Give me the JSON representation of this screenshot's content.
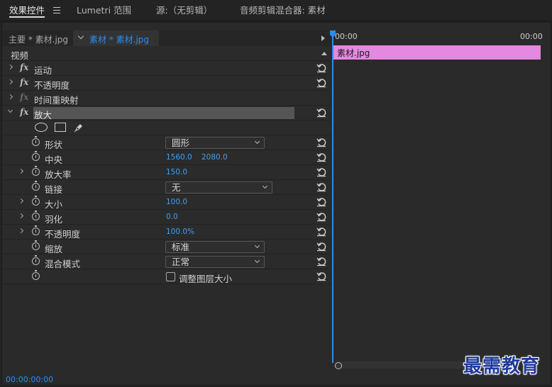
{
  "tabs": [
    {
      "label": "效果控件",
      "active": true
    },
    {
      "label": "Lumetri 范围",
      "active": false
    },
    {
      "label": "源:（无剪辑）",
      "active": false
    },
    {
      "label": "音频剪辑混合器: 素材",
      "active": false
    }
  ],
  "clip_header": {
    "master": "主要 * 素材.jpg",
    "sequence": "素材 * 素材.jpg"
  },
  "timeline": {
    "time_start": "00:00",
    "time_end": "00:00",
    "clip_label": "素材.jpg",
    "clip_color": "#e588e0"
  },
  "section_label": "视频",
  "effects": [
    {
      "name": "运动",
      "fx": "fx"
    },
    {
      "name": "不透明度",
      "fx": "fx"
    },
    {
      "name": "时间重映射",
      "fx": "fx"
    },
    {
      "name": "放大",
      "fx": "fx"
    }
  ],
  "magnify": {
    "shape_label": "形状",
    "shape_value": "圆形",
    "center_label": "中央",
    "center_x": "1560.0",
    "center_y": "2080.0",
    "zoom_label": "放大率",
    "zoom_value": "150.0",
    "link_label": "链接",
    "link_value": "无",
    "size_label": "大小",
    "size_value": "100.0",
    "feather_label": "羽化",
    "feather_value": "0.0",
    "opacity_label": "不透明度",
    "opacity_value": "100.0",
    "opacity_unit": "%",
    "scale_label": "缩放",
    "scale_value": "标准",
    "blend_label": "混合模式",
    "blend_value": "正常",
    "resize_label": "调整图层大小"
  },
  "footer": {
    "timecode": "00:00:00:00"
  },
  "watermark": "最需教育",
  "accent_color": "#2d8ceb"
}
